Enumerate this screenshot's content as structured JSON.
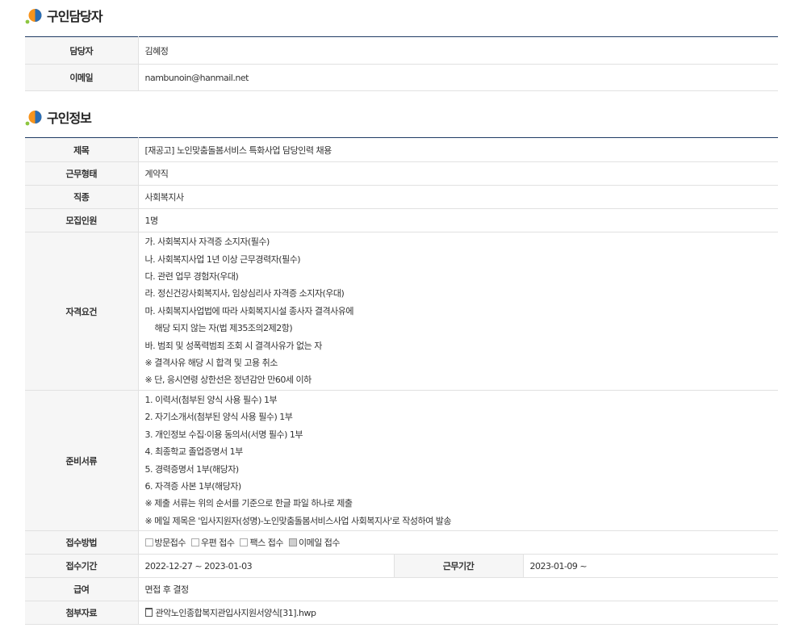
{
  "contact_section": {
    "title": "구인담당자",
    "rows": [
      {
        "label": "담당자",
        "value": "김혜정"
      },
      {
        "label": "이메일",
        "value": "nambunoin@hanmail.net"
      }
    ]
  },
  "job_section": {
    "title": "구인정보",
    "subject": {
      "label": "제목",
      "value": "[재공고] 노인맞춤돌봄서비스 특화사업 담당인력 채용"
    },
    "employment_type": {
      "label": "근무형태",
      "value": "계약직"
    },
    "job_category": {
      "label": "직종",
      "value": "사회복지사"
    },
    "headcount": {
      "label": "모집인원",
      "value": "1명"
    },
    "qualifications": {
      "label": "자격요건",
      "lines": [
        "가. 사회복지사 자격증 소지자(필수)",
        "나. 사회복지사업 1년 이상 근무경력자(필수)",
        "다. 관련 업무 경험자(우대)",
        "라. 정신건강사회복지사, 임상심리사 자격증 소지자(우대)",
        "마. 사회복지사업법에 따라 사회복지시설 종사자 결격사유에",
        "    해당 되지 않는 자(법 제35조의2제2항)",
        "바. 범죄 및 성폭력범죄 조회 시 결격사유가 없는 자",
        "※ 결격사유 해당 시 합격 및 고용 취소",
        "※ 단, 응시연령 상한선은 정년감안 만60세 이하"
      ]
    },
    "documents": {
      "label": "준비서류",
      "lines": [
        "1. 이력서(첨부된 양식 사용 필수) 1부",
        "2. 자기소개서(첨부된 양식 사용 필수) 1부",
        "3. 개인정보 수집·이용 동의서(서명 필수) 1부",
        "4. 최종학교 졸업증명서 1부",
        "5. 경력증명서 1부(해당자)",
        "6. 자격증 사본 1부(해당자)",
        "※ 제출 서류는 위의 순서를 기준으로 한글 파일 하나로 제출",
        "※ 메일 제목은 '입사지원자(성명)-노인맞춤돌봄서비스사업 사회복지사'로 작성하여 발송"
      ]
    },
    "application_method": {
      "label": "접수방법",
      "options": [
        {
          "label": "방문접수",
          "checked": false
        },
        {
          "label": "우편 접수",
          "checked": false
        },
        {
          "label": "팩스 접수",
          "checked": false
        },
        {
          "label": "이메일 접수",
          "checked": true
        }
      ]
    },
    "application_period": {
      "label": "접수기간",
      "value": "2022-12-27 ~ 2023-01-03"
    },
    "work_period": {
      "label": "근무기간",
      "value": "2023-01-09 ~"
    },
    "salary": {
      "label": "급여",
      "value": "면접 후 결정"
    },
    "attachment": {
      "label": "첨부자료",
      "file_icon": "file-icon",
      "value": "관악노인종합복지관입사지원서양식[31].hwp"
    }
  },
  "colors": {
    "accent_navy": "#1f3b64",
    "header_bg": "#f6f6f6",
    "icon_orange": "#f7941d",
    "icon_blue": "#2a6db5",
    "icon_green": "#8dc63f"
  }
}
